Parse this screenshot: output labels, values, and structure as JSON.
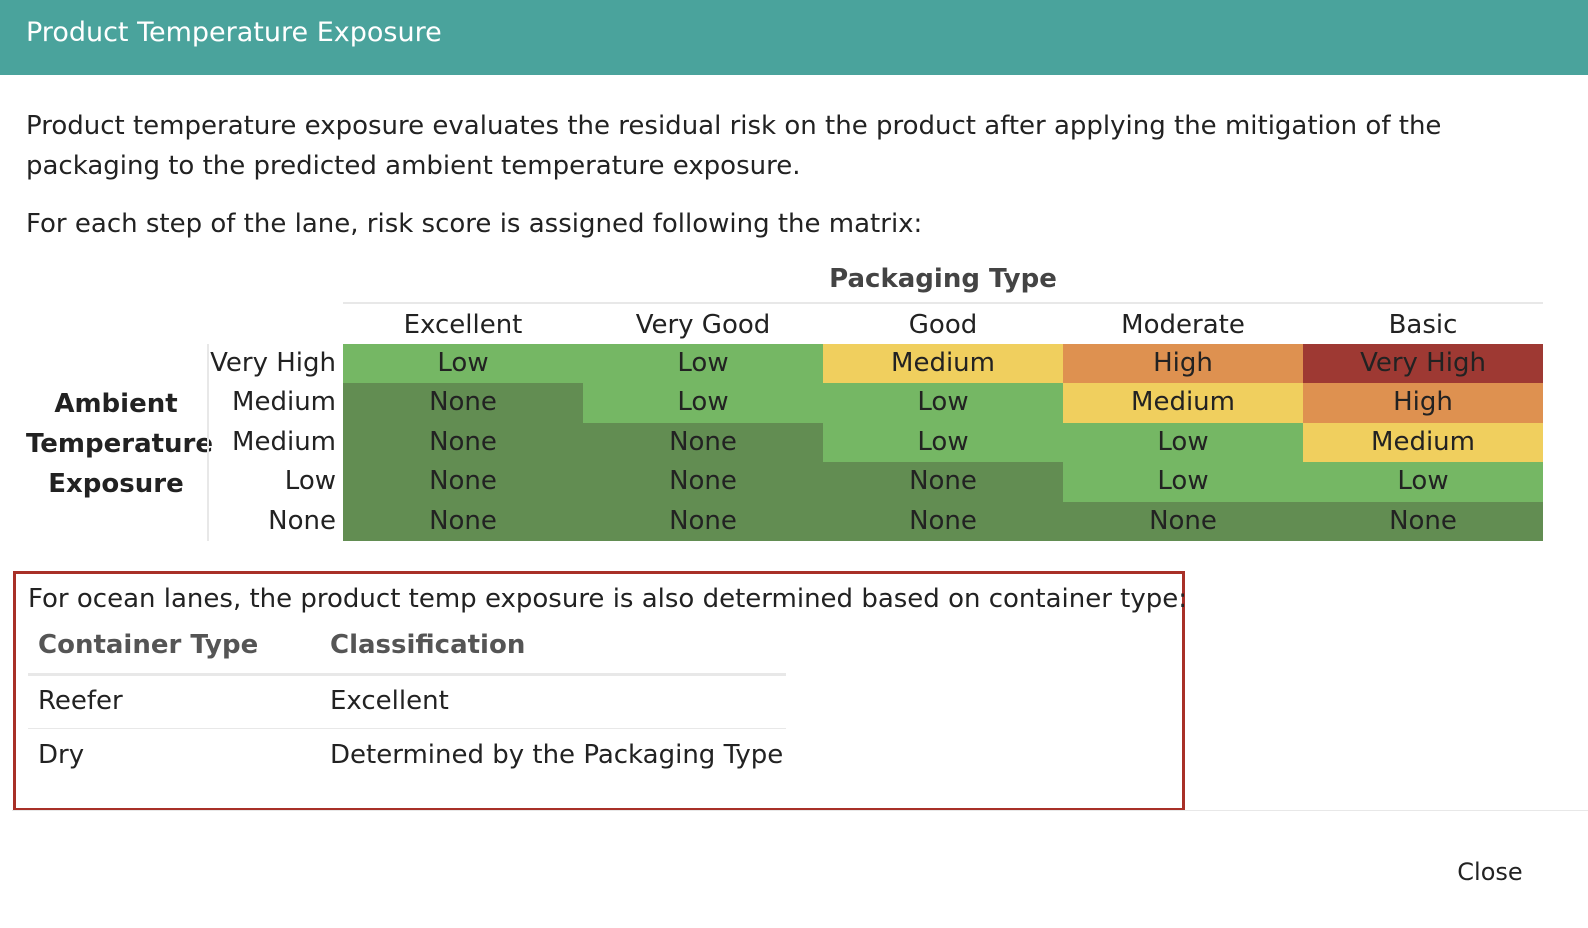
{
  "dialog": {
    "title": "Product Temperature Exposure"
  },
  "intro": {
    "paragraph": "Product temperature exposure evaluates the residual risk on the product after applying the mitigation of the packaging to the predicted ambient temperature exposure.",
    "matrix_lead": "For each step of the lane, risk score is assigned following the matrix:"
  },
  "matrix": {
    "column_group_title": "Packaging Type",
    "row_group_title_lines": [
      "Ambient",
      "Temperature",
      "Exposure"
    ],
    "columns": [
      "Excellent",
      "Very Good",
      "Good",
      "Moderate",
      "Basic"
    ],
    "rows": [
      {
        "label": "Very High",
        "cells": [
          "Low",
          "Low",
          "Medium",
          "High",
          "Very High"
        ]
      },
      {
        "label": "Medium",
        "cells": [
          "None",
          "Low",
          "Low",
          "Medium",
          "High"
        ]
      },
      {
        "label": "Medium",
        "cells": [
          "None",
          "None",
          "Low",
          "Low",
          "Medium"
        ]
      },
      {
        "label": "Low",
        "cells": [
          "None",
          "None",
          "None",
          "Low",
          "Low"
        ]
      },
      {
        "label": "None",
        "cells": [
          "None",
          "None",
          "None",
          "None",
          "None"
        ]
      }
    ],
    "colors": {
      "None": "#628d52",
      "Low": "#75b764",
      "Medium": "#f0cf5e",
      "High": "#de9150",
      "Very High": "#9e3933"
    }
  },
  "ocean": {
    "lead": "For ocean lanes, the product temp exposure is also determined based on container type:",
    "headers": [
      "Container Type",
      "Classification"
    ],
    "rows": [
      [
        "Reefer",
        "Excellent"
      ],
      [
        "Dry",
        "Determined by the Packaging Type"
      ]
    ],
    "border_color": "#a83028"
  },
  "footer": {
    "close_label": "Close"
  },
  "colors": {
    "header_bg": "#4aa39c"
  }
}
